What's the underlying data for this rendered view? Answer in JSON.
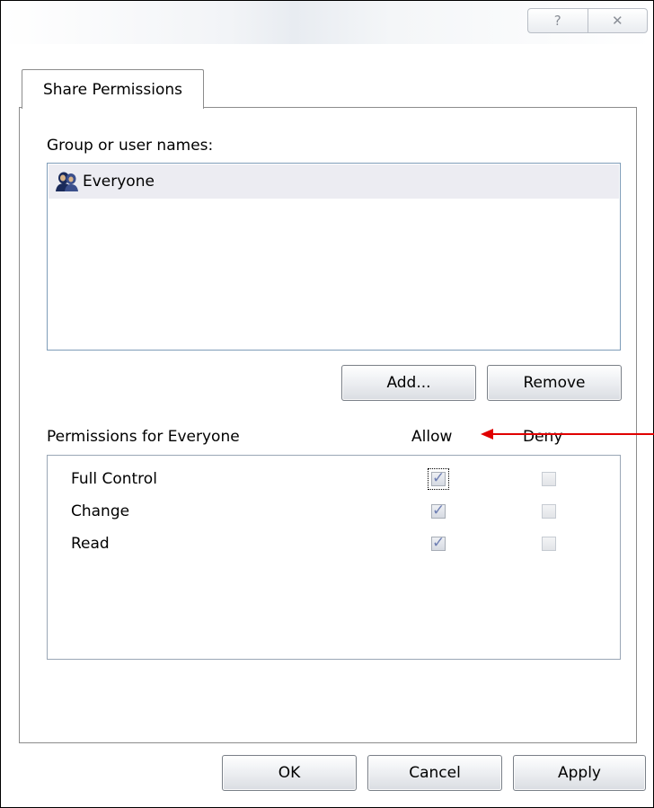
{
  "window": {
    "help_glyph": "?",
    "close_glyph": "✕"
  },
  "tab": {
    "label": "Share Permissions"
  },
  "users": {
    "label": "Group or user names:",
    "items": [
      {
        "name": "Everyone",
        "icon": "user-group-icon"
      }
    ]
  },
  "user_buttons": {
    "add_label": "Add...",
    "remove_label": "Remove"
  },
  "permissions": {
    "label": "Permissions for Everyone",
    "allow_header": "Allow",
    "deny_header": "Deny",
    "rows": [
      {
        "name": "Full Control",
        "allow": true,
        "deny": false
      },
      {
        "name": "Change",
        "allow": true,
        "deny": false
      },
      {
        "name": "Read",
        "allow": true,
        "deny": false
      }
    ]
  },
  "footer": {
    "ok_label": "OK",
    "cancel_label": "Cancel",
    "apply_label": "Apply"
  },
  "colors": {
    "annotation_arrow": "#e00000",
    "checkmark": "#6f7fb3",
    "selection": "#ececf2"
  }
}
